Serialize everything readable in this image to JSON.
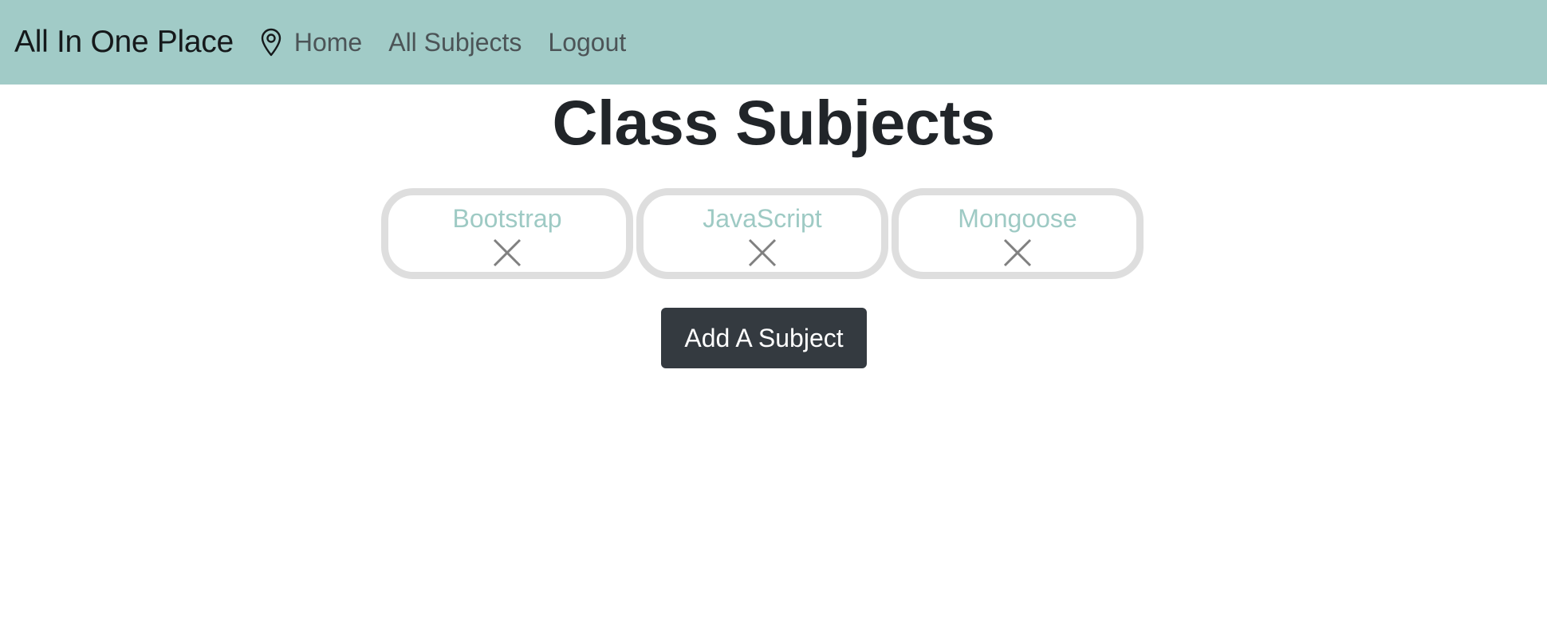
{
  "navbar": {
    "brand": "All In One Place",
    "icon": "map-pin-icon",
    "links": [
      {
        "label": "Home"
      },
      {
        "label": "All Subjects"
      },
      {
        "label": "Logout"
      }
    ],
    "background": "#a1cbc7"
  },
  "main": {
    "title": "Class Subjects",
    "subjects": [
      {
        "name": "Bootstrap",
        "delete_icon": "close-icon"
      },
      {
        "name": "JavaScript",
        "delete_icon": "close-icon"
      },
      {
        "name": "Mongoose",
        "delete_icon": "close-icon"
      }
    ],
    "add_button_label": "Add A Subject"
  },
  "colors": {
    "subject_text": "#9ecac4",
    "card_border": "#dedede",
    "button_bg": "#343a40"
  }
}
